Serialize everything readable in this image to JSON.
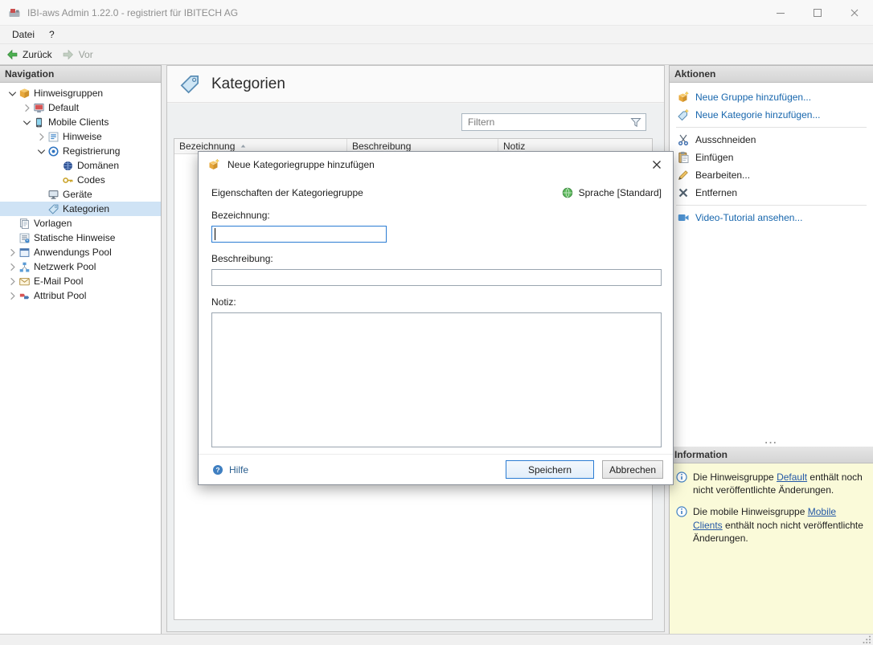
{
  "window": {
    "title": "IBI-aws Admin 1.22.0 - registriert für IBITECH AG"
  },
  "menubar": {
    "items": [
      {
        "label": "Datei"
      },
      {
        "label": "?"
      }
    ]
  },
  "toolbar": {
    "back_label": "Zurück",
    "forward_label": "Vor"
  },
  "navigation": {
    "header": "Navigation",
    "tree": [
      {
        "label": "Hinweisgruppen",
        "level": 0,
        "chevron": "expanded",
        "icon": "group-box-icon"
      },
      {
        "label": "Default",
        "level": 1,
        "chevron": "collapsed",
        "icon": "default-group-icon"
      },
      {
        "label": "Mobile Clients",
        "level": 1,
        "chevron": "expanded",
        "icon": "mobile-icon"
      },
      {
        "label": "Hinweise",
        "level": 2,
        "chevron": "collapsed",
        "icon": "hints-icon"
      },
      {
        "label": "Registrierung",
        "level": 2,
        "chevron": "expanded",
        "icon": "registration-icon"
      },
      {
        "label": "Domänen",
        "level": 3,
        "chevron": null,
        "icon": "domain-icon"
      },
      {
        "label": "Codes",
        "level": 3,
        "chevron": null,
        "icon": "key-icon"
      },
      {
        "label": "Geräte",
        "level": 2,
        "chevron": null,
        "icon": "device-icon"
      },
      {
        "label": "Kategorien",
        "level": 2,
        "chevron": null,
        "icon": "category-icon",
        "selected": true
      },
      {
        "label": "Vorlagen",
        "level": 0,
        "chevron": null,
        "icon": "template-icon"
      },
      {
        "label": "Statische Hinweise",
        "level": 0,
        "chevron": null,
        "icon": "static-hints-icon"
      },
      {
        "label": "Anwendungs Pool",
        "level": 0,
        "chevron": "collapsed",
        "icon": "app-pool-icon"
      },
      {
        "label": "Netzwerk Pool",
        "level": 0,
        "chevron": "collapsed",
        "icon": "network-pool-icon"
      },
      {
        "label": "E-Mail Pool",
        "level": 0,
        "chevron": "collapsed",
        "icon": "email-pool-icon"
      },
      {
        "label": "Attribut Pool",
        "level": 0,
        "chevron": "collapsed",
        "icon": "attribute-pool-icon"
      }
    ]
  },
  "content": {
    "title": "Kategorien",
    "filter_placeholder": "Filtern",
    "table": {
      "columns": [
        {
          "label": "Bezeichnung",
          "sorted": "asc"
        },
        {
          "label": "Beschreibung"
        },
        {
          "label": "Notiz"
        }
      ],
      "rows": []
    }
  },
  "dialog": {
    "title": "Neue Kategoriegruppe hinzufügen",
    "section_label": "Eigenschaften der Kategoriegruppe",
    "language_label": "Sprache [Standard]",
    "fields": [
      {
        "label": "Bezeichnung:",
        "value": ""
      },
      {
        "label": "Beschreibung:",
        "value": ""
      },
      {
        "label": "Notiz:",
        "value": ""
      }
    ],
    "help_label": "Hilfe",
    "save_label": "Speichern",
    "cancel_label": "Abbrechen"
  },
  "actions": {
    "header": "Aktionen",
    "overflow": "...",
    "items": [
      {
        "type": "link",
        "label": "Neue Gruppe hinzufügen...",
        "icon": "new-group-icon"
      },
      {
        "type": "link",
        "label": "Neue Kategorie hinzufügen...",
        "icon": "new-category-icon"
      },
      {
        "type": "separator"
      },
      {
        "type": "item",
        "label": "Ausschneiden",
        "icon": "cut-icon"
      },
      {
        "type": "item",
        "label": "Einfügen",
        "icon": "paste-icon"
      },
      {
        "type": "item",
        "label": "Bearbeiten...",
        "icon": "edit-icon"
      },
      {
        "type": "item",
        "label": "Entfernen",
        "icon": "remove-icon"
      },
      {
        "type": "separator"
      },
      {
        "type": "link",
        "label": "Video-Tutorial ansehen...",
        "icon": "video-icon"
      }
    ]
  },
  "information": {
    "header": "Information",
    "messages": [
      {
        "prefix": "Die Hinweisgruppe ",
        "link": "Default",
        "suffix": " enthält noch nicht veröffentlichte Änderungen."
      },
      {
        "prefix": "Die mobile Hinweisgruppe ",
        "link": "Mobile Clients",
        "suffix": " enthält noch nicht veröffentlichte Änderungen."
      }
    ]
  },
  "colors": {
    "accent_focus_border": "#2b7cd3",
    "link_blue": "#1766ad",
    "info_panel_bg": "#fafad9",
    "selected_item_bg": "#cfe3f5"
  }
}
